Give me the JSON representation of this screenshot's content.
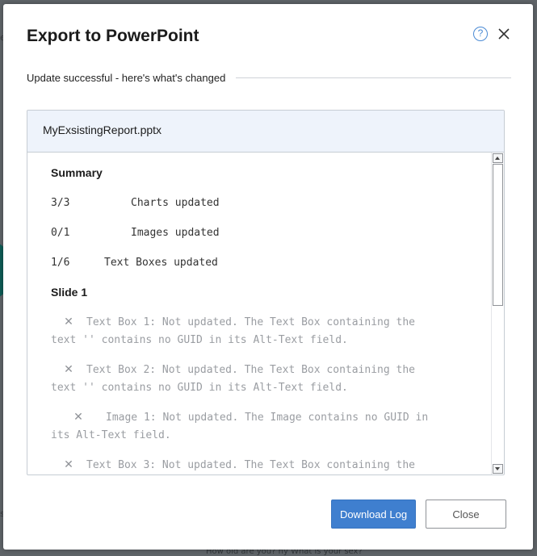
{
  "dialog": {
    "title": "Export to PowerPoint",
    "help_glyph": "?",
    "close_icon": "close-icon",
    "section_label": "Update successful - here's what's changed"
  },
  "report": {
    "filename": "MyExsistingReport.pptx",
    "summary_heading": "Summary",
    "summary": [
      {
        "count": "3/3",
        "label": "Charts updated"
      },
      {
        "count": "0/1",
        "label": "Images updated"
      },
      {
        "count": "1/6",
        "label": "Text Boxes updated"
      }
    ],
    "slide_heading": "Slide 1",
    "entries": [
      {
        "icon": "x-icon",
        "line1": "Text Box 1: Not updated. The Text Box containing the",
        "line2": "text '' contains no GUID in its Alt-Text field."
      },
      {
        "icon": "x-icon",
        "line1": "Text Box 2: Not updated. The Text Box containing the",
        "line2": "text '' contains no GUID in its Alt-Text field."
      },
      {
        "icon": "x-icon",
        "line1": "Image 1: Not updated. The Image contains no GUID in",
        "line2": "its Alt-Text field."
      },
      {
        "icon": "x-icon",
        "line1": "Text Box 3: Not updated. The Text Box containing the",
        "line2": ""
      }
    ]
  },
  "buttons": {
    "download": "Download Log",
    "close": "Close"
  },
  "backdrop": {
    "fragment_e": "e",
    "fragment_s": "s",
    "bottom_text": "How old are you? hy What is your sex?"
  },
  "colors": {
    "primary": "#3f7fcf",
    "header_bg": "#eef3fb",
    "help_accent": "#4a8ad4",
    "muted_text": "#9a9da2",
    "overlay": "#5f6468"
  }
}
